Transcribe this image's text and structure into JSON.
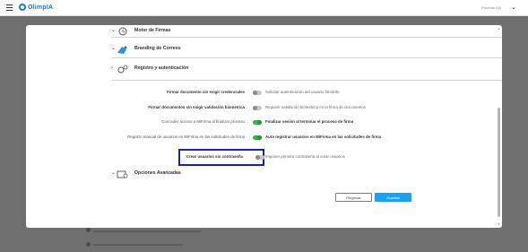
{
  "app": {
    "logo_text": "OlimpIA",
    "user_name": "Pruebas QA"
  },
  "sections": {
    "motor_firmas": "Motor de Firmas",
    "branding_correos": "Branding de Correos",
    "registro_autenticacion": "Registro y autenticación",
    "opciones_avanzadas": "Opciones Avanzadas"
  },
  "options": [
    {
      "left": "Firmar documento sin exigir credenciales",
      "right": "Solicitar autenticación del usuario firmante",
      "enabled": false
    },
    {
      "left": "Firmar documentos sin exigir validación biometrica",
      "right": "Requerir validación biometrica en la firma de documentos",
      "enabled": false
    },
    {
      "left": "Conceder acceso a MiFirma al finalizar proceso",
      "right": "Finalizar sesión al terminar el proceso de firma",
      "enabled": true
    },
    {
      "left": "Registro manual de usuarios en MiFirma en las solicitudes de firma",
      "right": "Auto registrar usuarios en MiFirma en las solicitudes de firma",
      "enabled": true
    },
    {
      "left": "Crear usuarios sin contraseña",
      "right": "Imponer primera contraseña al crear usuarios",
      "enabled": false
    }
  ],
  "buttons": {
    "back": "Regresar",
    "save": "Guardar"
  },
  "colors": {
    "brand": "#1f78c8",
    "toggle_on": "#2fb34a",
    "primary_button": "#1aa1f0",
    "highlight_border": "#1a26a8"
  }
}
